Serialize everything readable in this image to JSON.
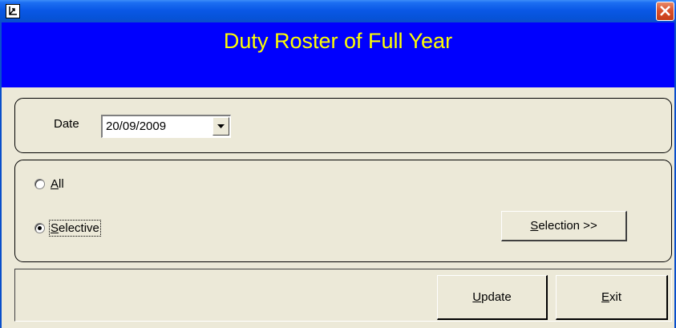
{
  "window": {
    "icon": "document-app-icon",
    "close_icon": "close-icon"
  },
  "header": {
    "title": "Duty Roster of Full Year",
    "background": "#0000fe",
    "color": "#ffff00"
  },
  "date_group": {
    "label": "Date",
    "value": "20/09/2009",
    "dropdown_icon": "chevron-down-icon"
  },
  "selection_group": {
    "options": [
      {
        "label_prefix": "",
        "accel": "A",
        "label_rest": "ll",
        "selected": false
      },
      {
        "label_prefix": "",
        "accel": "S",
        "label_rest": "elective",
        "selected": true
      }
    ],
    "selection_button": {
      "accel": "S",
      "rest": "election >>"
    }
  },
  "actions": {
    "update": {
      "accel": "U",
      "rest": "pdate"
    },
    "exit": {
      "accel": "E",
      "rest": "xit"
    }
  },
  "colors": {
    "titlebar": "#0653d8",
    "window_bg": "#ece9d8",
    "close_button": "#d9512c"
  }
}
